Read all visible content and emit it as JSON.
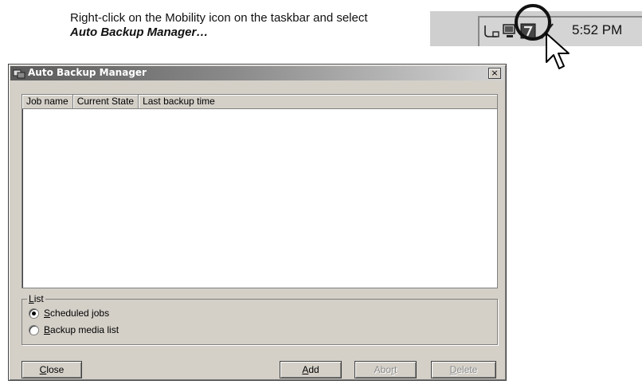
{
  "instruction": {
    "line1": "Right-click on the Mobility icon on the taskbar and select",
    "line2": "Auto Backup Manager…"
  },
  "taskbar": {
    "clock": "5:52 PM",
    "icons": [
      "network-icon",
      "monitor-icon",
      "mobility-icon",
      "checkmark-icon"
    ]
  },
  "window": {
    "title": "Auto Backup Manager",
    "close_glyph": "×",
    "columns": [
      "Job name",
      "Current State",
      "Last backup time"
    ],
    "rows": [],
    "group": {
      "legend_prefix": "",
      "legend_key": "L",
      "legend_rest": "ist",
      "options": [
        {
          "key": "S",
          "rest": "cheduled jobs",
          "checked": true
        },
        {
          "key": "B",
          "rest": "ackup media list",
          "checked": false
        }
      ]
    },
    "buttons": {
      "close": {
        "pre": "",
        "key": "C",
        "post": "lose",
        "enabled": true
      },
      "add": {
        "pre": "",
        "key": "A",
        "post": "dd",
        "enabled": true
      },
      "abort": {
        "pre": "Abo",
        "key": "r",
        "post": "t",
        "enabled": false
      },
      "delete": {
        "pre": "",
        "key": "D",
        "post": "elete",
        "enabled": false
      }
    }
  }
}
